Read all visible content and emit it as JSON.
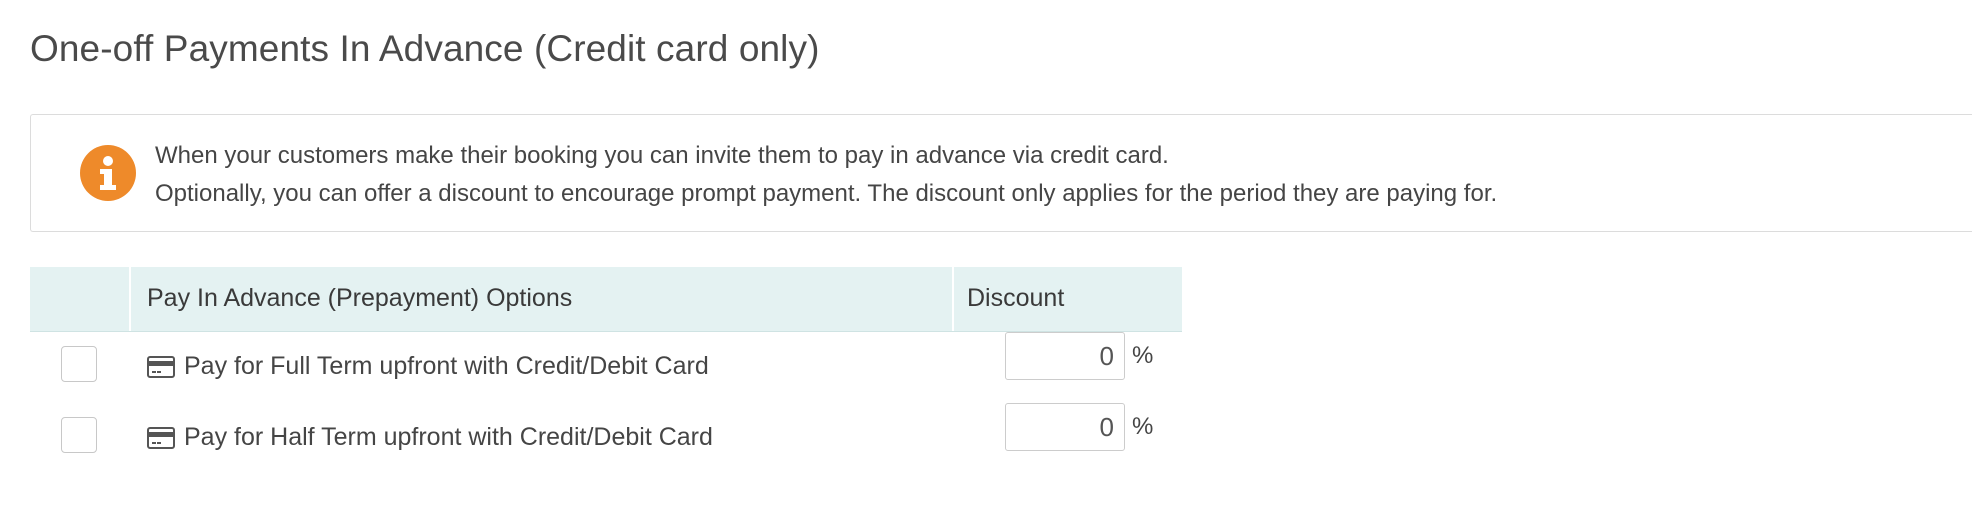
{
  "page": {
    "title": "One-off Payments In Advance (Credit card only)"
  },
  "info": {
    "icon": "info-icon",
    "accent_color": "#ee8a2a",
    "line1": "When your customers make their booking you can invite them to pay in advance via credit card.",
    "line2": "Optionally, you can offer a discount to encourage prompt payment. The discount only applies for the period they are paying for."
  },
  "table": {
    "header_bg": "#e4f2f2",
    "columns": {
      "options": "Pay In Advance (Prepayment) Options",
      "discount": "Discount"
    },
    "rows": [
      {
        "icon": "credit-card-icon",
        "label": "Pay for Full Term upfront with Credit/Debit Card",
        "checked": false,
        "discount": "0",
        "unit": "%"
      },
      {
        "icon": "credit-card-icon",
        "label": "Pay for Half Term upfront with Credit/Debit Card",
        "checked": false,
        "discount": "0",
        "unit": "%"
      }
    ]
  }
}
